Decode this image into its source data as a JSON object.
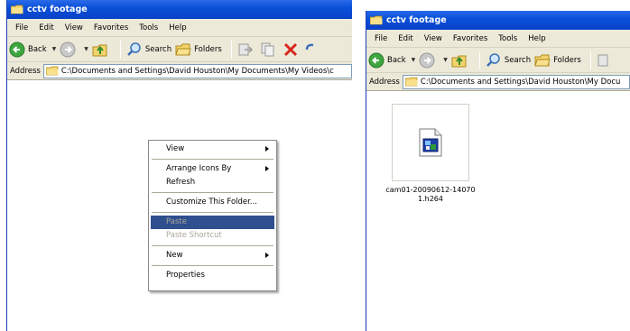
{
  "windows": {
    "left": {
      "title": "cctv footage",
      "menu": [
        "File",
        "Edit",
        "View",
        "Favorites",
        "Tools",
        "Help"
      ],
      "toolbar": {
        "back": "Back",
        "search": "Search",
        "folders": "Folders"
      },
      "address": {
        "label": "Address",
        "path": "C:\\Documents and Settings\\David Houston\\My Documents\\My Videos\\c"
      },
      "context_menu": {
        "view": "View",
        "arrange_icons_by": "Arrange Icons By",
        "refresh": "Refresh",
        "customize": "Customize This Folder...",
        "paste": "Paste",
        "paste_shortcut": "Paste Shortcut",
        "new": "New",
        "properties": "Properties"
      }
    },
    "right": {
      "title": "cctv footage",
      "menu": [
        "File",
        "Edit",
        "View",
        "Favorites",
        "Tools",
        "Help"
      ],
      "toolbar": {
        "back": "Back",
        "search": "Search",
        "folders": "Folders"
      },
      "address": {
        "label": "Address",
        "path": "C:\\Documents and Settings\\David Houston\\My Docu"
      },
      "file": {
        "name": "cam01-20090612-14070\n1.h264"
      }
    }
  },
  "colors": {
    "titlebar": "#0a50d8",
    "menu_highlight": "#2f4f8e",
    "chrome": "#ece9d8"
  }
}
